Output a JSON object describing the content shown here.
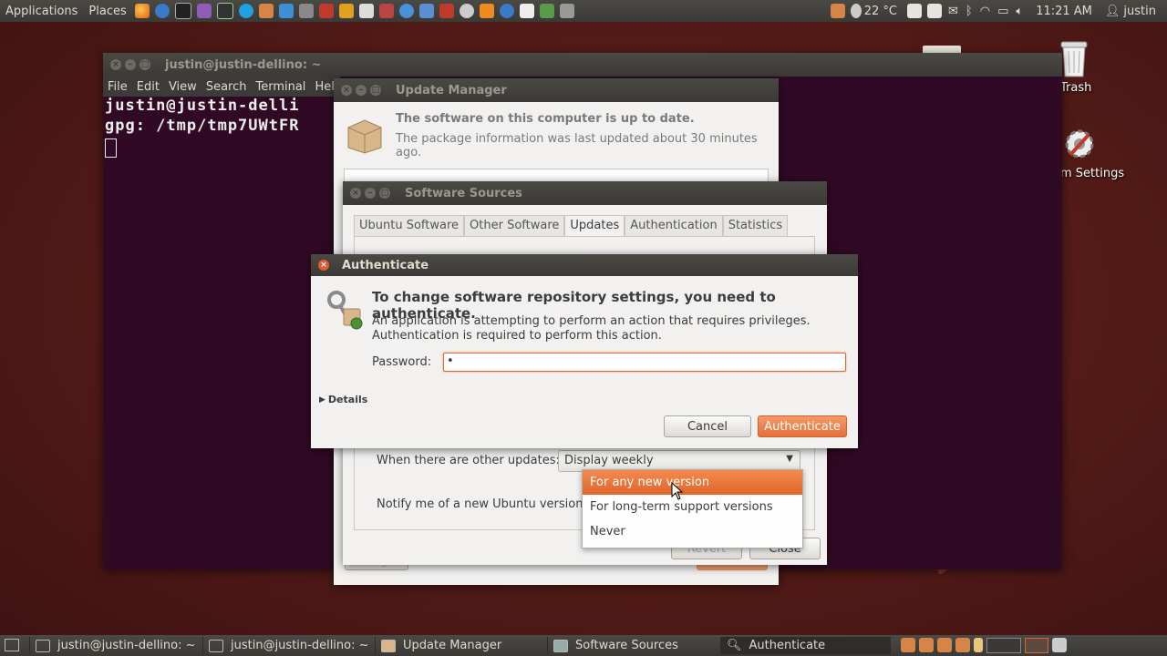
{
  "top_panel": {
    "menus": [
      "Applications",
      "Places"
    ],
    "weather": "22 °C",
    "clock": "11:21 AM",
    "user": "justin"
  },
  "desktop": {
    "trash_label": "Trash",
    "settings_label": "m Settings"
  },
  "terminal": {
    "title": "justin@justin-dellino: ~",
    "menu": [
      "File",
      "Edit",
      "View",
      "Search",
      "Terminal",
      "Help"
    ],
    "lines": [
      "justin@justin-delli",
      "gpg: /tmp/tmp7UWtFR"
    ]
  },
  "update_manager": {
    "title": "Update Manager",
    "status_title": "The software on this computer is up to date.",
    "status_sub": "The package information was last updated about 30 minutes ago."
  },
  "software_sources": {
    "title": "Software Sources",
    "tabs": [
      "Ubuntu Software",
      "Other Software",
      "Updates",
      "Authentication",
      "Statistics"
    ],
    "active_tab": "Updates",
    "other_updates_label": "When there are other updates:",
    "other_updates_value": "Display weekly",
    "notify_label": "Notify me of a new Ubuntu version:",
    "notify_options": [
      "For any new version",
      "For long-term support versions",
      "Never"
    ],
    "selected_option": "For any new version",
    "revert_label": "Revert",
    "close_label": "Close"
  },
  "auth_dialog": {
    "title": "Authenticate",
    "heading": "To change software repository settings, you need to authenticate.",
    "line1": "An application is attempting to perform an action that requires privileges.",
    "line2": "Authentication is required to perform this action.",
    "password_label": "Password:",
    "password_value": "•",
    "details_label": "Details",
    "cancel_label": "Cancel",
    "authenticate_label": "Authenticate"
  },
  "taskbar": {
    "tasks": [
      "justin@justin-dellino: ~",
      "justin@justin-dellino: ~",
      "Update Manager",
      "Software Sources",
      "Authenticate"
    ]
  },
  "colors": {
    "accent": "#e65a2f",
    "panel": "#3c3b37",
    "terminal_bg": "#300a24"
  }
}
